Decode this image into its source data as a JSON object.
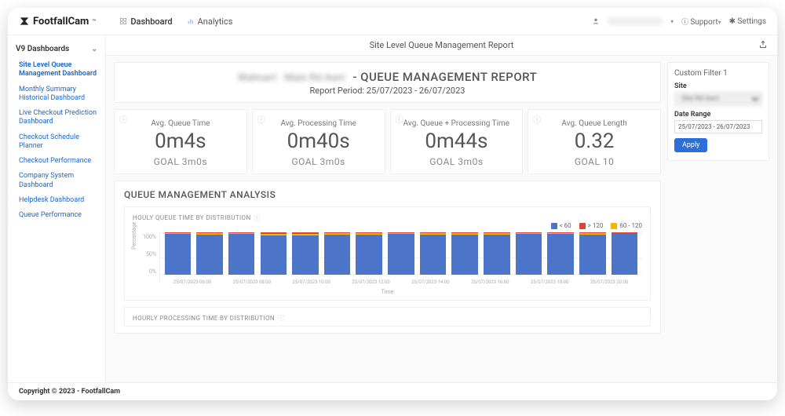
{
  "brand": "FootfallCam",
  "topnav": {
    "dashboard": "Dashboard",
    "analytics": "Analytics"
  },
  "topright": {
    "support": "Support",
    "settings": "Settings"
  },
  "sidebar": {
    "group": "V9 Dashboards",
    "items": [
      "Site Level Queue Management Dashboard",
      "Monthly Summary Historical Dashboard",
      "Live Checkout Prediction Dashboard",
      "Checkout Schedule Planner",
      "Checkout Performance",
      "Company System Dashboard",
      "Helpdesk Dashboard",
      "Queue Performance"
    ]
  },
  "page_header": "Site Level Queue Management Report",
  "report": {
    "subject_blur": "Walmart · Main Rd Awri",
    "title": "QUEUE MANAGEMENT REPORT",
    "separator": " -  ",
    "period_label": "Report Period: 25/07/2023 - 26/07/2023"
  },
  "filter": {
    "title": "Custom Filter 1",
    "site_label": "Site",
    "site_value": "Site Rd Awri",
    "date_label": "Date Range",
    "date_value": "25/07/2023 - 26/07/2023",
    "apply": "Apply"
  },
  "kpis": [
    {
      "label": "Avg. Queue Time",
      "value": "0m4s",
      "goal": "GOAL 3m0s"
    },
    {
      "label": "Avg. Processing Time",
      "value": "0m40s",
      "goal": "GOAL 3m0s"
    },
    {
      "label": "Avg. Queue + Processing Time",
      "value": "0m44s",
      "goal": "GOAL 3m0s"
    },
    {
      "label": "Avg. Queue Length",
      "value": "0.32",
      "goal": "GOAL 10"
    }
  ],
  "analysis_title": "QUEUE MANAGEMENT ANALYSIS",
  "chart1": {
    "title": "HOULY QUEUE TIME BY DISTRIBUTION",
    "legend": [
      {
        "label": "< 60",
        "color": "#4c74c9"
      },
      {
        "label": "> 120",
        "color": "#db4437"
      },
      {
        "label": "60 - 120",
        "color": "#f4b400"
      }
    ],
    "ylabel": "Percentage",
    "xlabel": "Time"
  },
  "chart2": {
    "title": "HOURLY PROCESSING TIME BY DISTRIBUTION"
  },
  "footer": "Copyright © 2023 - FootfallCam",
  "chart_data": {
    "type": "bar",
    "stacked": true,
    "ylabel": "Percentage",
    "xlabel": "Time",
    "ylim": [
      0,
      100
    ],
    "yticks": [
      0,
      50,
      100
    ],
    "categories": [
      "25/07/2023 06:00",
      "25/07/2023 07:00",
      "25/07/2023 08:00",
      "25/07/2023 09:00",
      "25/07/2023 10:00",
      "25/07/2023 11:00",
      "25/07/2023 12:00",
      "25/07/2023 13:00",
      "25/07/2023 14:00",
      "25/07/2023 15:00",
      "25/07/2023 16:00",
      "25/07/2023 17:00",
      "25/07/2023 18:00",
      "25/07/2023 19:00",
      "25/07/2023 20:00"
    ],
    "xticks_shown": [
      "25/07/2023 06:00",
      "25/07/2023 08:00",
      "25/07/2023 10:00",
      "25/07/2023 12:00",
      "25/07/2023 14:00",
      "25/07/2023 16:00",
      "25/07/2023 18:00",
      "25/07/2023 20:00"
    ],
    "series": [
      {
        "name": "< 60",
        "color": "#4c74c9",
        "values": [
          97,
          95,
          96,
          93,
          92,
          94,
          95,
          96,
          95,
          94,
          95,
          96,
          97,
          95,
          98
        ]
      },
      {
        "name": "60 - 120",
        "color": "#f4b400",
        "values": [
          2,
          3,
          3,
          4,
          5,
          4,
          3,
          3,
          3,
          4,
          3,
          3,
          2,
          3,
          1
        ]
      },
      {
        "name": "> 120",
        "color": "#db4437",
        "values": [
          1,
          2,
          1,
          3,
          3,
          2,
          2,
          1,
          2,
          2,
          2,
          1,
          1,
          2,
          1
        ]
      }
    ]
  }
}
